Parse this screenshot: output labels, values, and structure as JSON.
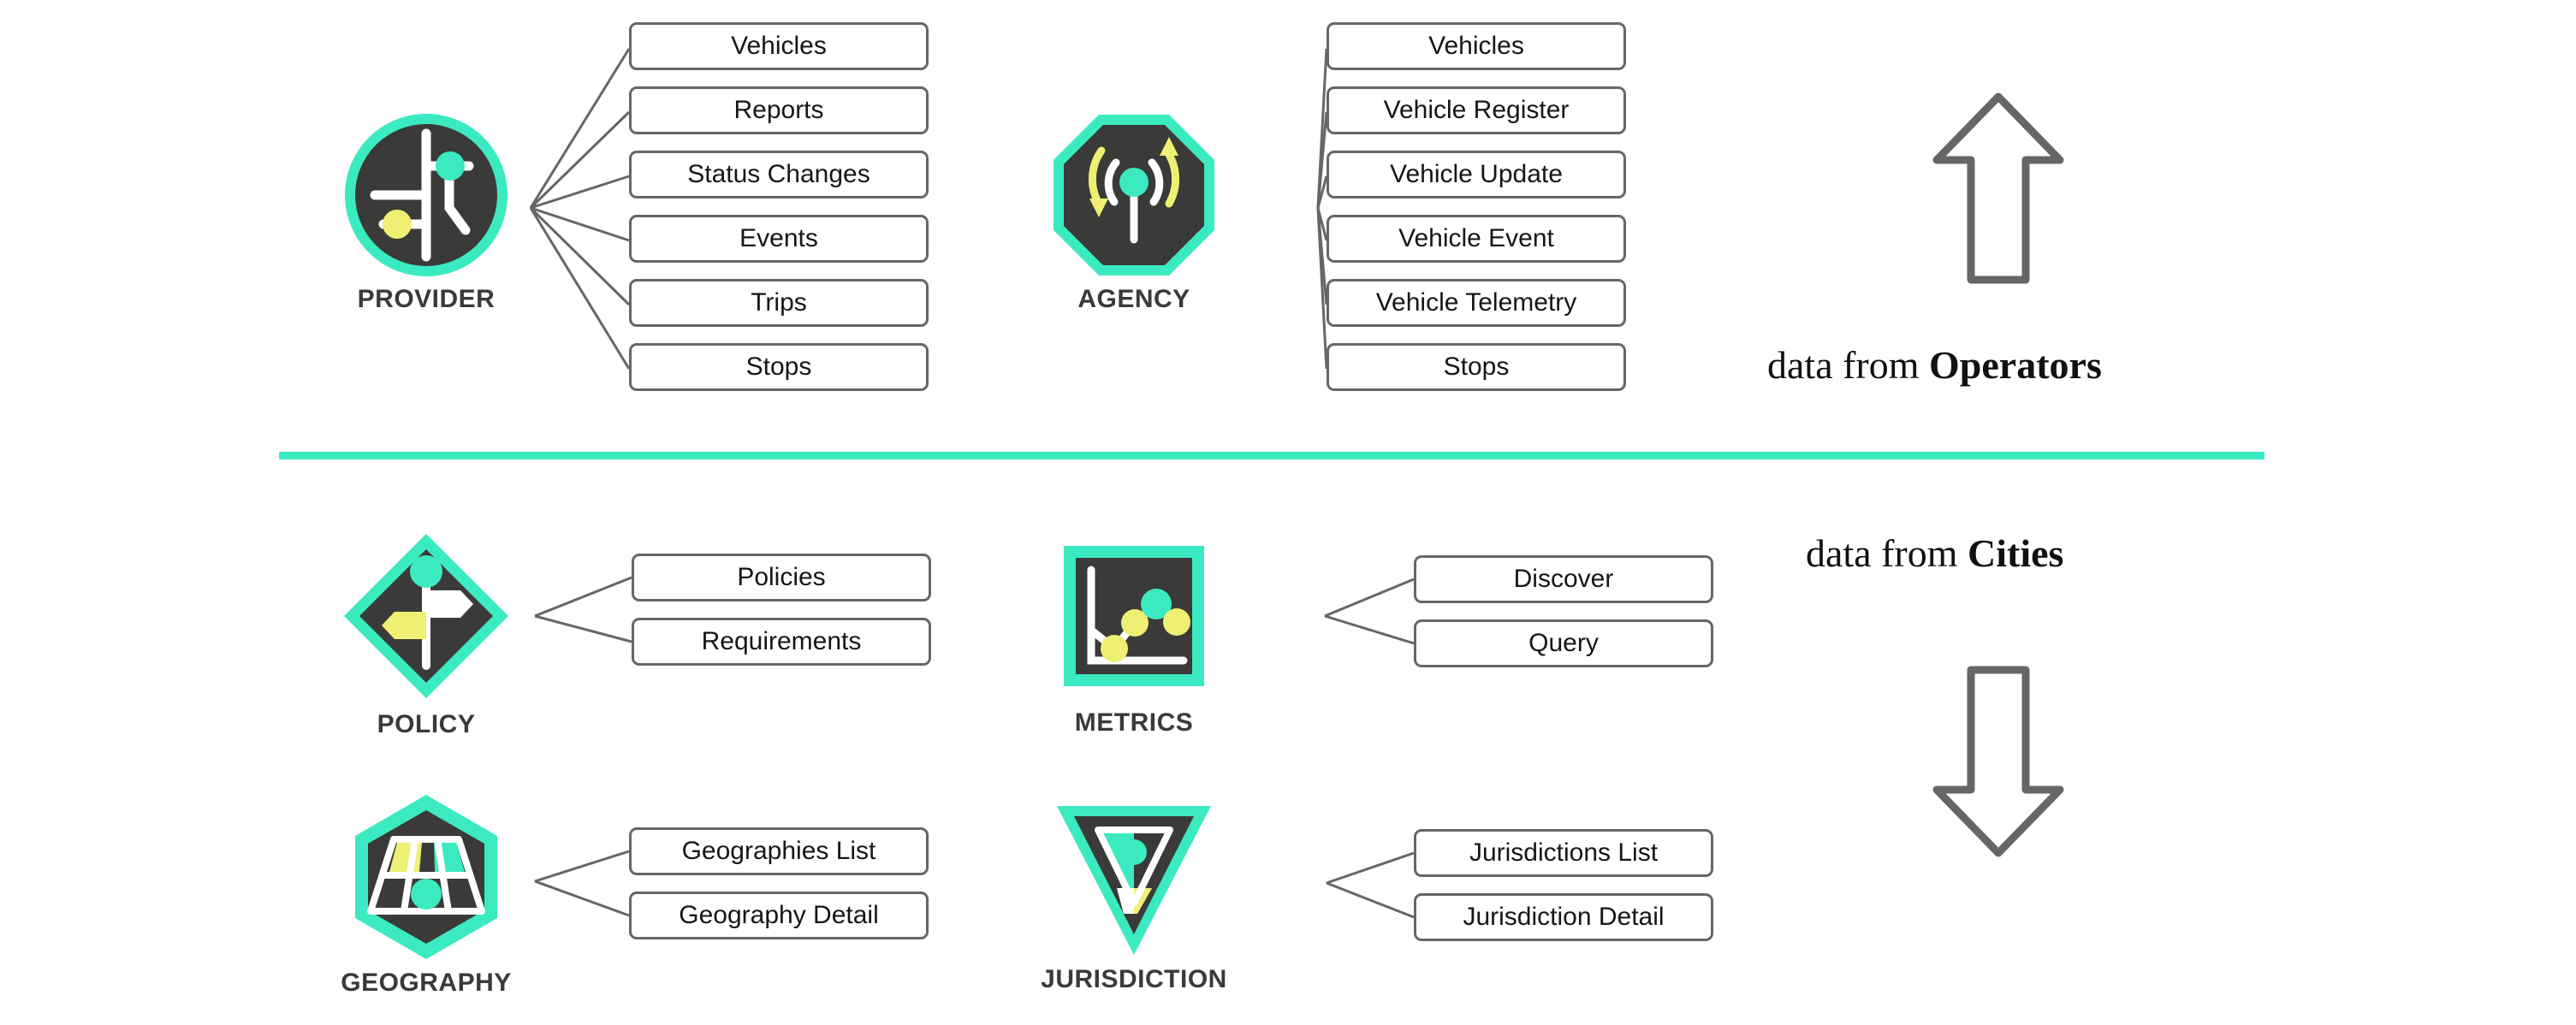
{
  "theme": {
    "accent_teal": "#3BEAC0",
    "accent_yellow": "#EFEF74",
    "icon_fill": "#3A3A38",
    "line_gray": "#666664",
    "text_dark": "#16161a",
    "background": "#ffffff"
  },
  "divider": {
    "color": "#3BEAC0"
  },
  "nodes": [
    {
      "id": "provider",
      "label": "PROVIDER",
      "icon": "provider-road-circle-icon",
      "shape": "circle",
      "endpoints": [
        "Vehicles",
        "Reports",
        "Status Changes",
        "Events",
        "Trips",
        "Stops"
      ]
    },
    {
      "id": "agency",
      "label": "AGENCY",
      "icon": "agency-broadcast-octagon-icon",
      "shape": "octagon",
      "endpoints": [
        "Vehicles",
        "Vehicle Register",
        "Vehicle Update",
        "Vehicle Event",
        "Vehicle Telemetry",
        "Stops"
      ]
    },
    {
      "id": "policy",
      "label": "POLICY",
      "icon": "policy-signpost-diamond-icon",
      "shape": "diamond",
      "endpoints": [
        "Policies",
        "Requirements"
      ]
    },
    {
      "id": "metrics",
      "label": "METRICS",
      "icon": "metrics-linechart-square-icon",
      "shape": "square",
      "endpoints": [
        "Discover",
        "Query"
      ]
    },
    {
      "id": "geography",
      "label": "GEOGRAPHY",
      "icon": "geography-roadgrid-hexagon-icon",
      "shape": "hexagon",
      "endpoints": [
        "Geographies List",
        "Geography Detail"
      ]
    },
    {
      "id": "jurisdiction",
      "label": "JURISDICTION",
      "icon": "jurisdiction-triangle-icon",
      "shape": "triangle-down",
      "endpoints": [
        "Jurisdictions List",
        "Jurisdiction Detail"
      ]
    }
  ],
  "captions": {
    "operators": {
      "prefix": "data from ",
      "emphasis": "Operators",
      "arrow": "arrow-up-outline-icon"
    },
    "cities": {
      "prefix": "data from ",
      "emphasis": "Cities",
      "arrow": "arrow-down-outline-icon"
    }
  }
}
